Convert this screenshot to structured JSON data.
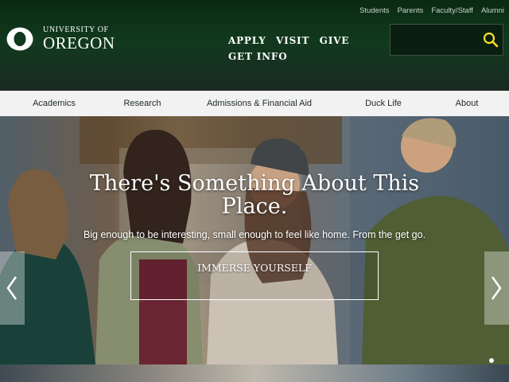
{
  "utility_nav": [
    "Students",
    "Parents",
    "Faculty/Staff",
    "Alumni"
  ],
  "logo": {
    "line1": "UNIVERSITY OF",
    "line2": "OREGON"
  },
  "primary_nav": [
    "APPLY",
    "VISIT",
    "GIVE",
    "GET INFO"
  ],
  "search": {
    "value": "",
    "icon": "search-icon",
    "icon_color": "#fce122"
  },
  "secondary_nav": [
    "Academics",
    "Research",
    "Admissions & Financial Aid",
    "Duck Life",
    "About"
  ],
  "hero": {
    "title": "There's Something About This Place.",
    "subtitle": "Big enough to be interesting, small enough to feel like home. From the get go.",
    "cta": "IMMERSE YOURSELF",
    "prev_icon": "chevron-left-icon",
    "next_icon": "chevron-right-icon"
  },
  "colors": {
    "header_green": "#154733",
    "accent_yellow": "#fce122",
    "nav_bg": "#f2f2f2"
  }
}
